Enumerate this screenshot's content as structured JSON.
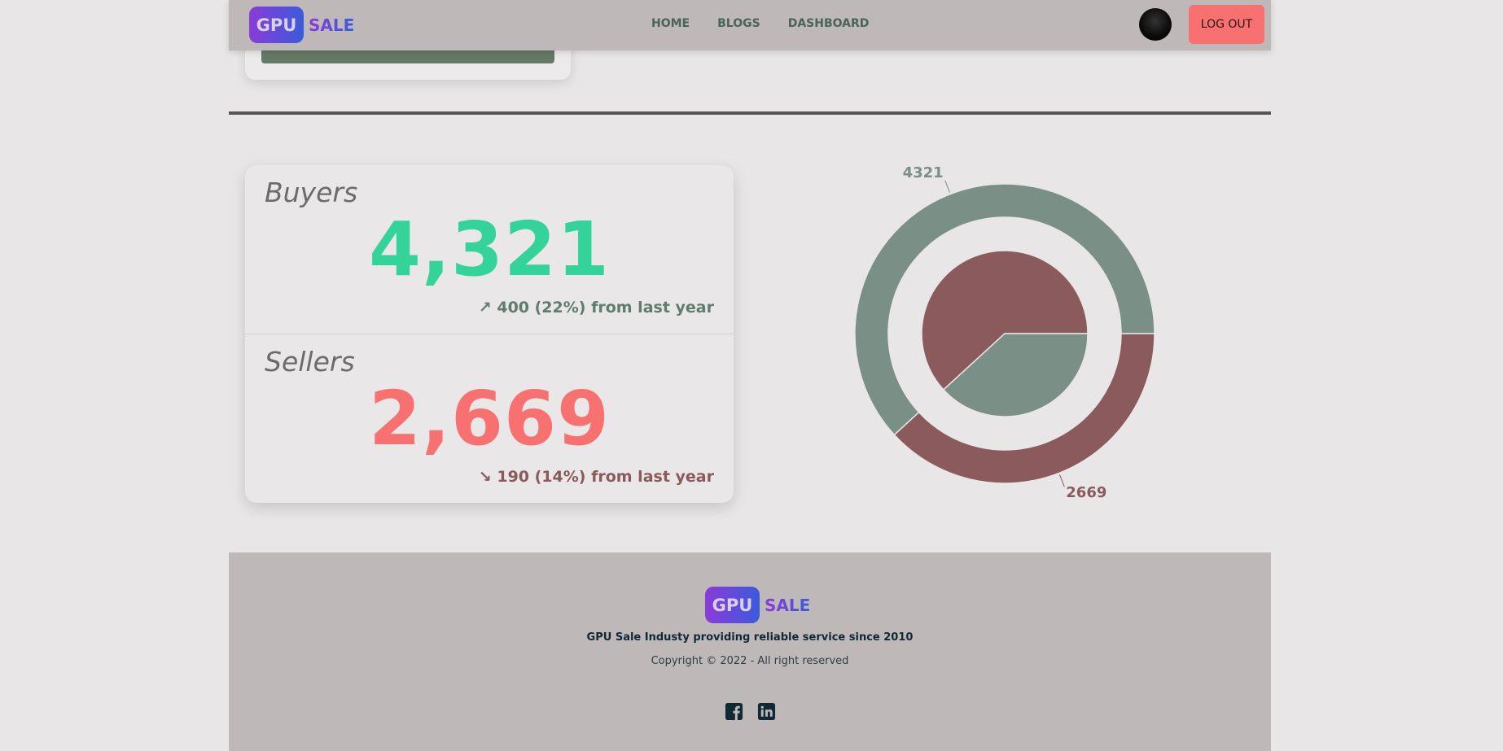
{
  "header": {
    "logo": {
      "gpu": "GPU",
      "sale": "SALE"
    },
    "nav": [
      "HOME",
      "BLOGS",
      "DASHBOARD"
    ],
    "logout_label": "LOG OUT"
  },
  "stats": {
    "buyers": {
      "label": "Buyers",
      "value": "4,321",
      "change": "↗ 400 (22%) from last year",
      "value_color": "#34d399",
      "change_color": "#5f7d6e"
    },
    "sellers": {
      "label": "Sellers",
      "value": "2,669",
      "change": "↘ 190 (14%) from last year",
      "value_color": "#f87171",
      "change_color": "#8a5a5a"
    }
  },
  "chart_data": {
    "type": "pie",
    "variant": "donut-with-inner-pie",
    "outer_ring": {
      "values": [
        4321,
        2669
      ],
      "data_labels": [
        "4321",
        "2669"
      ],
      "colors": [
        "#7a8f86",
        "#8a5a5c"
      ]
    },
    "inner_pie": {
      "values": [
        4321,
        2669
      ],
      "colors": [
        "#8a5a5c",
        "#7a8f86"
      ]
    }
  },
  "footer": {
    "logo": {
      "gpu": "GPU",
      "sale": "SALE"
    },
    "tagline": "GPU Sale Industy providing reliable service since 2010",
    "copyright": "Copyright © 2022 - All right reserved",
    "social_icons": [
      "facebook-icon",
      "linkedin-icon"
    ]
  }
}
